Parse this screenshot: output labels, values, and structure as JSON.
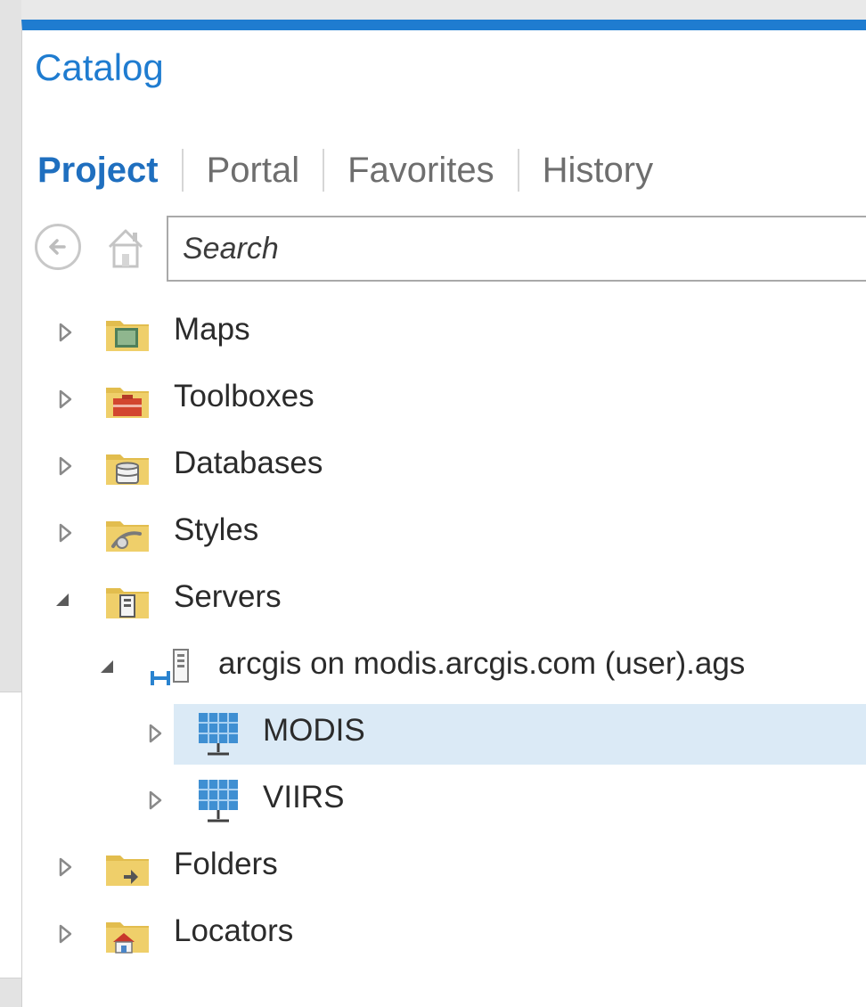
{
  "pane": {
    "title": "Catalog"
  },
  "tabs": [
    {
      "label": "Project",
      "active": true
    },
    {
      "label": "Portal",
      "active": false
    },
    {
      "label": "Favorites",
      "active": false
    },
    {
      "label": "History",
      "active": false
    }
  ],
  "search": {
    "placeholder": "Search",
    "value": ""
  },
  "tree": {
    "items": [
      {
        "label": "Maps",
        "icon": "maps-folder-icon",
        "expanded": false
      },
      {
        "label": "Toolboxes",
        "icon": "toolboxes-folder-icon",
        "expanded": false
      },
      {
        "label": "Databases",
        "icon": "databases-folder-icon",
        "expanded": false
      },
      {
        "label": "Styles",
        "icon": "styles-folder-icon",
        "expanded": false
      },
      {
        "label": "Servers",
        "icon": "servers-folder-icon",
        "expanded": true,
        "children": [
          {
            "label": "arcgis on modis.arcgis.com (user).ags",
            "icon": "server-connection-icon",
            "expanded": true,
            "children": [
              {
                "label": "MODIS",
                "icon": "image-service-icon",
                "expanded": false,
                "selected": true
              },
              {
                "label": "VIIRS",
                "icon": "image-service-icon",
                "expanded": false,
                "selected": false
              }
            ]
          }
        ]
      },
      {
        "label": "Folders",
        "icon": "folders-folder-icon",
        "expanded": false
      },
      {
        "label": "Locators",
        "icon": "locators-folder-icon",
        "expanded": false
      }
    ]
  },
  "colors": {
    "accent": "#1f7cd0",
    "tab_active": "#1f6fbf",
    "selection": "#dbeaf6",
    "folder": "#e8c65a"
  }
}
